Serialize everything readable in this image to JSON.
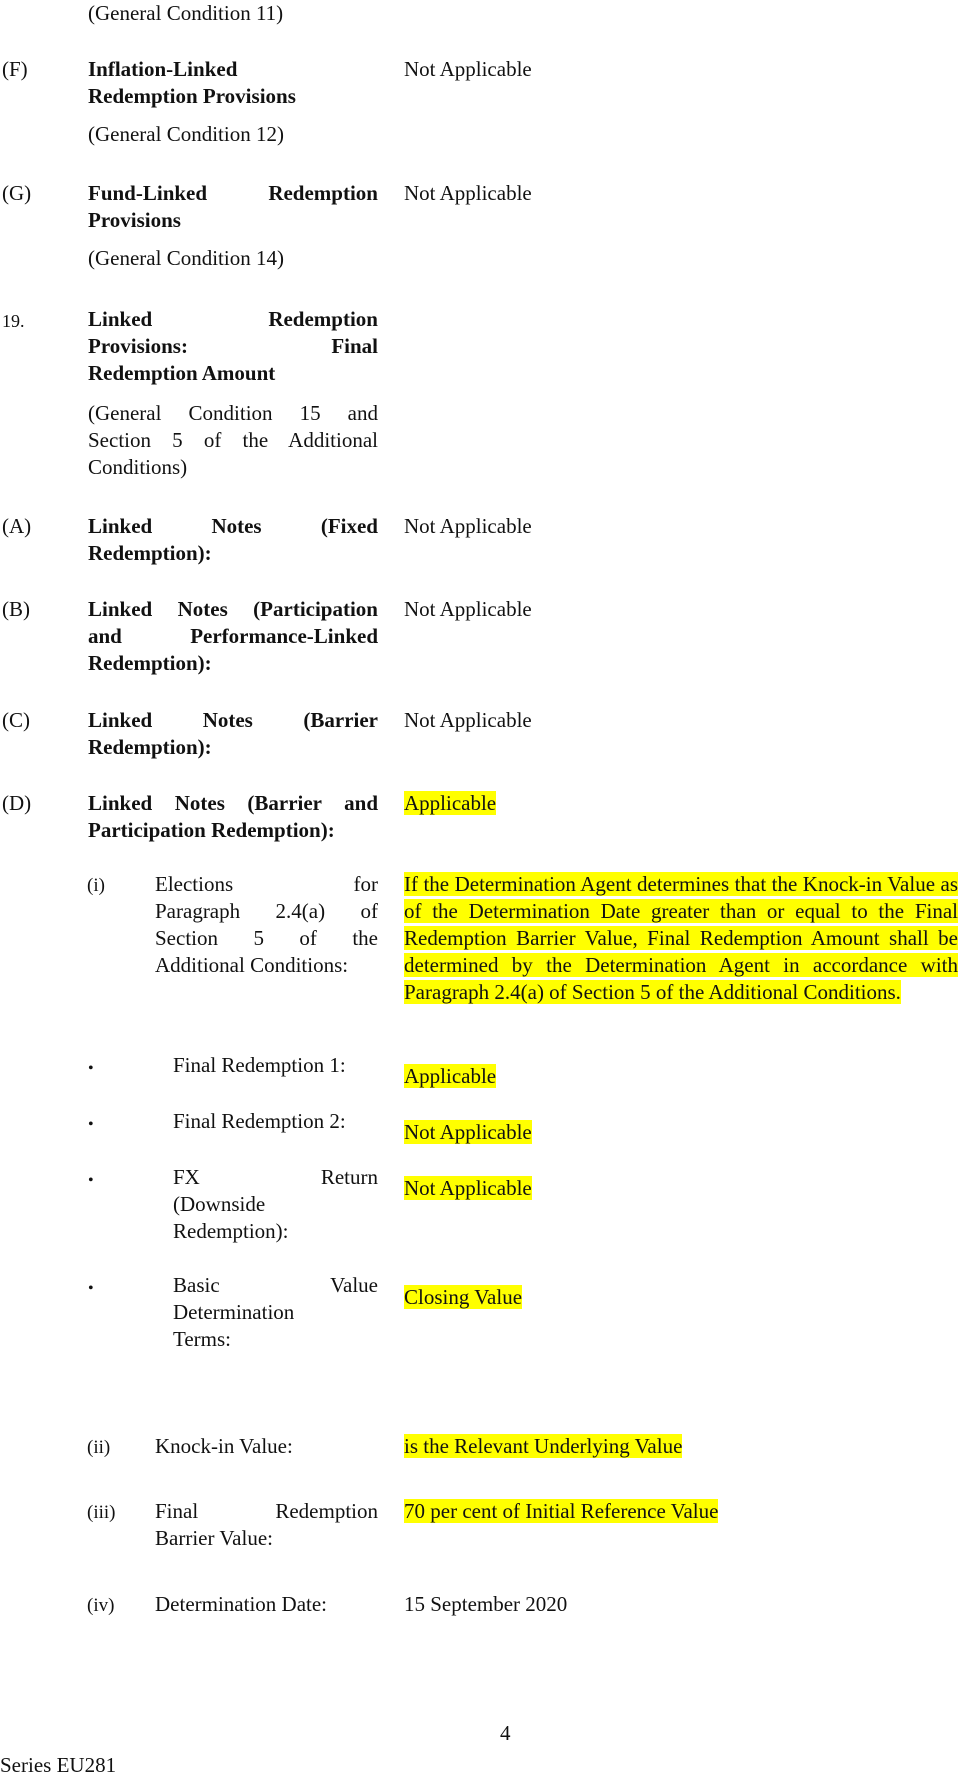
{
  "document": {
    "page_number": "4",
    "footer": "Series EU281",
    "highlight_color": "#ffff00"
  },
  "top_condition": "(General Condition 11)",
  "items": {
    "F": {
      "label": "(F)",
      "title_line1": "Inflation-Linked",
      "title_line2": "Redemption Provisions",
      "condition": "(General Condition 12)",
      "value": "Not Applicable"
    },
    "G": {
      "label": "(G)",
      "title_line1": "Fund-Linked Redemption",
      "title_line2": "Provisions",
      "condition": "(General Condition 14)",
      "value": "Not Applicable"
    },
    "s19": {
      "label": "19.",
      "title_line1": "Linked Redemption",
      "title_line2": "Provisions: Final",
      "title_line3": "Redemption Amount",
      "condition_line1": "(General Condition 15 and",
      "condition_line2": "Section 5 of the Additional",
      "condition_line3": "Conditions)"
    },
    "A": {
      "label": "(A)",
      "title_line1": "Linked Notes (Fixed",
      "title_line2": "Redemption):",
      "value": "Not Applicable"
    },
    "B": {
      "label": "(B)",
      "title_line1": "Linked Notes (Participation",
      "title_line2": "and Performance-Linked",
      "title_line3": "Redemption):",
      "value": "Not Applicable"
    },
    "C": {
      "label": "(C)",
      "title_line1": "Linked Notes (Barrier",
      "title_line2": "Redemption):",
      "value": "Not Applicable"
    },
    "D": {
      "label": "(D)",
      "title_line1": "Linked Notes (Barrier and",
      "title_line2": "Participation Redemption):",
      "value": "Applicable"
    }
  },
  "sub_items": {
    "i": {
      "label": "(i)",
      "text_line1": "Elections for",
      "text_line2": "Paragraph 2.4(a) of",
      "text_line3": "Section 5 of the",
      "text_line4": "Additional Conditions:",
      "value": "If the Determination Agent determines that the Knock-in Value as of the Determination Date greater than or equal to the Final Redemption Barrier Value, Final Redemption Amount shall be determined by the Determination Agent in accordance with Paragraph 2.4(a) of Section 5 of the Additional Conditions."
    },
    "bullets": [
      {
        "lines": [
          "Final Redemption 1:"
        ],
        "value": "Applicable"
      },
      {
        "lines": [
          "Final Redemption 2:"
        ],
        "value": "Not Applicable"
      },
      {
        "lines": [
          "FX Return",
          "(Downside",
          "Redemption):"
        ],
        "value": "Not Applicable"
      },
      {
        "lines": [
          "Basic Value",
          "Determination",
          "Terms:"
        ],
        "value": "Closing Value"
      }
    ],
    "ii": {
      "label": "(ii)",
      "text": "Knock-in Value:",
      "value": "is the Relevant Underlying Value"
    },
    "iii": {
      "label": "(iii)",
      "text_line1": "Final Redemption",
      "text_line2": "Barrier Value:",
      "value": "70 per cent of Initial Reference Value"
    },
    "iv": {
      "label": "(iv)",
      "text": "Determination Date:",
      "value": "15 September 2020"
    }
  },
  "icons": {
    "bullet": "•"
  }
}
